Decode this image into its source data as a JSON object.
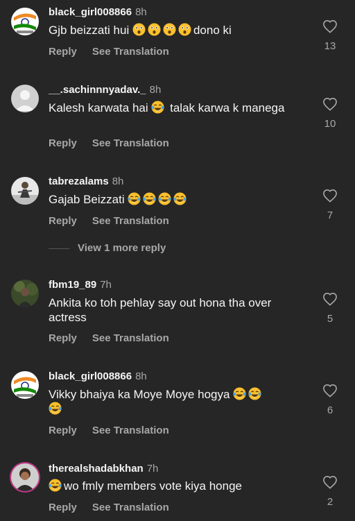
{
  "labels": {
    "reply": "Reply",
    "see_translation": "See Translation",
    "view_more": "View 1 more reply"
  },
  "comments": [
    {
      "username": "black_girl008866",
      "time": "8h",
      "text_before": "Gjb beizzati hui",
      "emoji": "astonished-face",
      "emoji_count": 4,
      "text_after": "dono ki",
      "likes": "13"
    },
    {
      "username": "__.sachinnnyadav._",
      "time": "8h",
      "text_before": "Kalesh karwata hai",
      "emoji": "face-with-tears-of-joy",
      "emoji_count": 1,
      "text_after": "talak karwa k manega",
      "likes": "10"
    },
    {
      "username": "tabrezalams",
      "time": "8h",
      "text_before": "Gajab Beizzati",
      "emoji": "face-with-tears-of-joy",
      "emoji_count": 4,
      "text_after": "",
      "likes": "7"
    },
    {
      "username": "fbm19_89",
      "time": "7h",
      "text_before": "Ankita ko toh pehlay say out hona tha over actress",
      "emoji": "",
      "emoji_count": 0,
      "text_after": "",
      "likes": "5"
    },
    {
      "username": "black_girl008866",
      "time": "8h",
      "text_before": "Vikky bhaiya ka Moye Moye hogya",
      "emoji": "face-with-tears-of-joy",
      "emoji_count": 3,
      "text_after": "",
      "likes": "6"
    },
    {
      "username": "therealshadabkhan",
      "time": "7h",
      "text_before": "",
      "emoji": "face-with-tears-of-joy",
      "emoji_count": 1,
      "text_after": "wo fmly members vote kiya honge",
      "likes": "2"
    }
  ],
  "colors": {
    "background": "#262626",
    "text_primary": "#f5f5f5",
    "text_secondary": "#a8a8a8"
  }
}
